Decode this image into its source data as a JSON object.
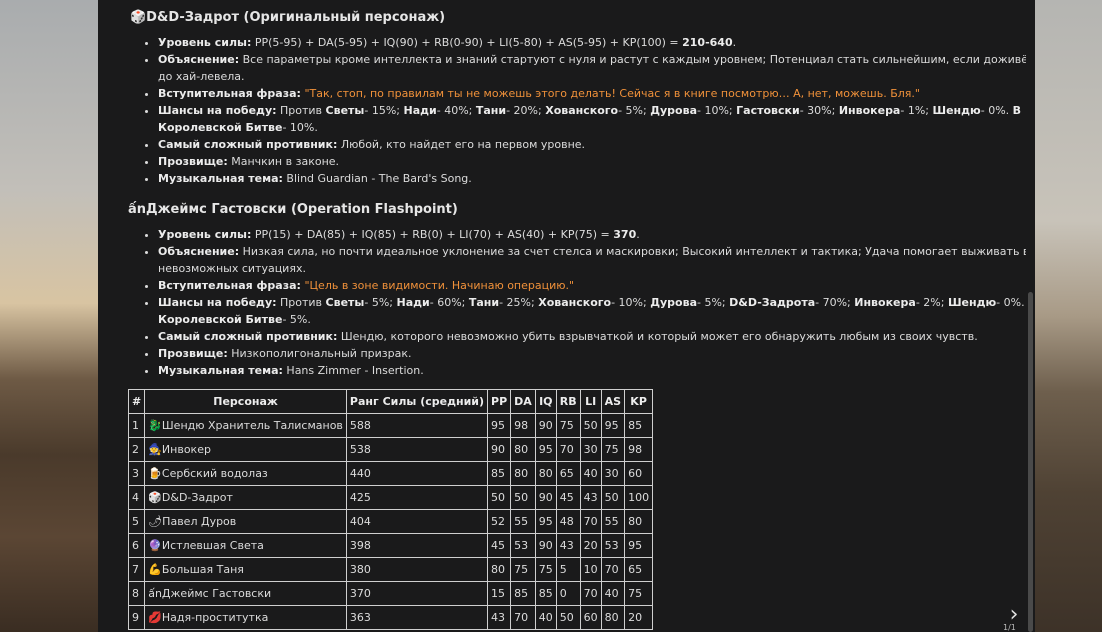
{
  "section1": {
    "title": "🎲D&D-Задрот (Оригинальный персонаж)",
    "items": [
      {
        "label": "Уровень силы:",
        "text": " PP(5-95) + DA(5-95) + IQ(90) + RB(0-90) + LI(5-80) + AS(5-95) + KP(100) = ",
        "bold_tail": "210-640",
        "tail": "."
      },
      {
        "label": "Объяснение:",
        "text": " Все параметры кроме интеллекта и знаний стартуют с нуля и растут с каждым уровнем; Потенциал стать сильнейшим, если доживёт до хай-левела."
      },
      {
        "label": "Вступительная фраза:",
        "quote": " \"Так, стоп, по правилам ты не можешь этого делать! Сейчас я в книге посмотрю… А, нет, можешь. Бля.\""
      },
      {
        "label": "Шансы на победу:",
        "html": " Против <b>Светы</b>- 15%; <b>Нади</b>- 40%; <b>Тани</b>- 20%; <b>Хованского</b>- 5%; <b>Дурова</b>- 10%; <b>Гастовски</b>- 30%; <b>Инвокера</b>- 1%; <b>Шендю</b>- 0%. <b>В Королевской Битве</b>- 10%."
      },
      {
        "label": "Самый сложный противник:",
        "text": " Любой, кто найдет его на первом уровне."
      },
      {
        "label": "Прозвище:",
        "text": " Манчкин в законе."
      },
      {
        "label": "Музыкальная тема:",
        "text": " Blind Guardian - The Bard's Song."
      }
    ]
  },
  "section2": {
    "title": "ấnДжеймс Гастовски (Operation Flashpoint)",
    "items": [
      {
        "label": "Уровень силы:",
        "text": " PP(15) + DA(85) + IQ(85) + RB(0) + LI(70) + AS(40) + KP(75) = ",
        "bold_tail": "370",
        "tail": "."
      },
      {
        "label": "Объяснение:",
        "text": " Низкая сила, но почти идеальное уклонение за счет стелса и маскировки; Высокий интеллект и тактика; Удача помогает выживать в невозможных ситуациях."
      },
      {
        "label": "Вступительная фраза:",
        "quote": " \"Цель в зоне видимости. Начинаю операцию.\""
      },
      {
        "label": "Шансы на победу:",
        "html": " Против <b>Светы</b>- 5%; <b>Нади</b>- 60%; <b>Тани</b>- 25%; <b>Хованского</b>- 10%; <b>Дурова</b>- 5%; <b>D&amp;D-Задрота</b>- 70%; <b>Инвокера</b>- 2%; <b>Шендю</b>- 0%. <b>В Королевской Битве</b>- 5%."
      },
      {
        "label": "Самый сложный противник:",
        "text": " Шендю, которого невозможно убить взрывчаткой и который может его обнаружить любым из своих чувств."
      },
      {
        "label": "Прозвище:",
        "text": " Низкополигональный призрак."
      },
      {
        "label": "Музыкальная тема:",
        "text": " Hans Zimmer - Insertion."
      }
    ]
  },
  "table": {
    "headers": [
      "#",
      "Персонаж",
      "Ранг Силы (средний)",
      "PP",
      "DA",
      "IQ",
      "RB",
      "LI",
      "AS",
      "KP"
    ],
    "rows": [
      [
        "1",
        "🐉Шендю Хранитель Талисманов",
        "588",
        "95",
        "98",
        "90",
        "75",
        "50",
        "95",
        "85"
      ],
      [
        "2",
        "🧙Инвокер",
        "538",
        "90",
        "80",
        "95",
        "70",
        "30",
        "75",
        "98"
      ],
      [
        "3",
        "🍺Сербский водолаз",
        "440",
        "85",
        "80",
        "80",
        "65",
        "40",
        "30",
        "60"
      ],
      [
        "4",
        "🎲D&D-Задрот",
        "425",
        "50",
        "50",
        "90",
        "45",
        "43",
        "50",
        "100"
      ],
      [
        "5",
        "🌶Павел Дуров",
        "404",
        "52",
        "55",
        "95",
        "48",
        "70",
        "55",
        "80"
      ],
      [
        "6",
        "🔮Истлевшая Света",
        "398",
        "45",
        "53",
        "90",
        "43",
        "20",
        "53",
        "95"
      ],
      [
        "7",
        "💪Большая Таня",
        "380",
        "80",
        "75",
        "75",
        "5",
        "10",
        "70",
        "65"
      ],
      [
        "8",
        "ấnДжеймс Гастовски",
        "370",
        "15",
        "85",
        "85",
        "0",
        "70",
        "40",
        "75"
      ],
      [
        "9",
        "💋Надя-проститутка",
        "363",
        "43",
        "70",
        "40",
        "50",
        "60",
        "80",
        "20"
      ]
    ]
  },
  "nav": {
    "next_icon": "chevron-right-icon",
    "page": "1/1"
  },
  "colors": {
    "panel": "#1a1a1b",
    "quote": "#f0913a",
    "text": "#dcdcdc"
  }
}
